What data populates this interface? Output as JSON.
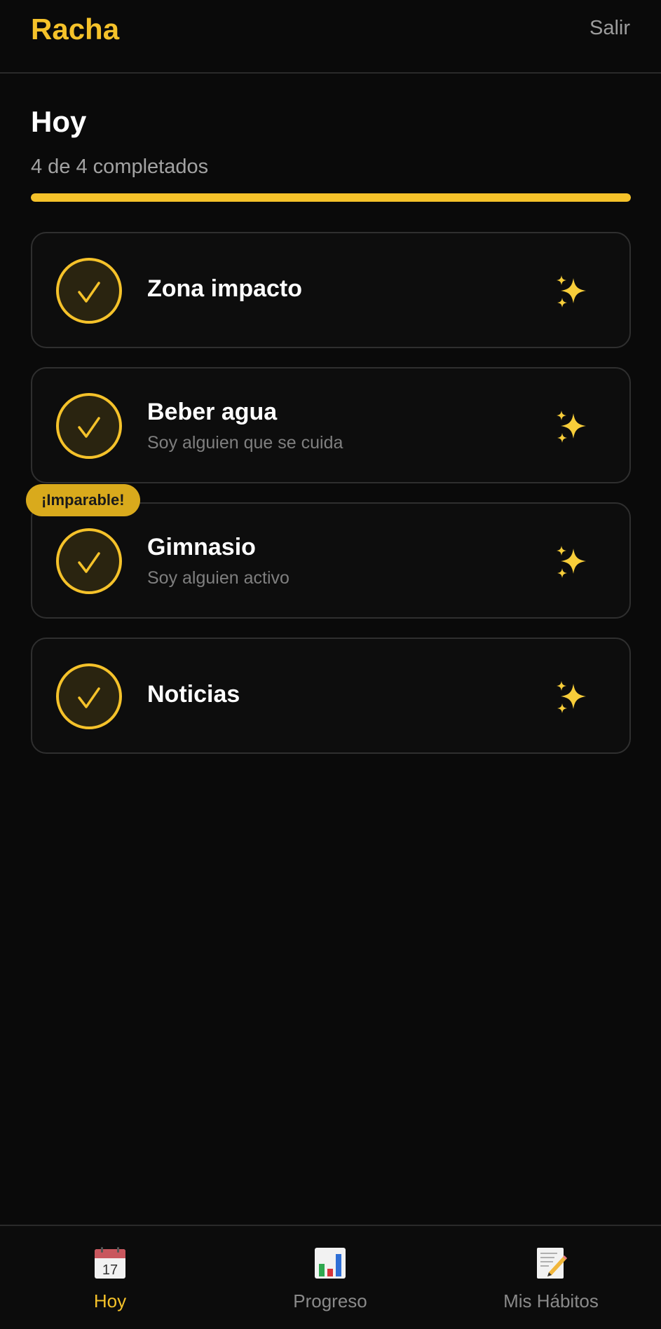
{
  "header": {
    "brand": "Racha",
    "logout_label": "Salir"
  },
  "today": {
    "title": "Hoy",
    "progress_text": "4 de 4 completados",
    "completed": 4,
    "total": 4,
    "progress_fraction": 1.0
  },
  "colors": {
    "accent": "#f5c22a",
    "background": "#0a0a0a",
    "badge": "#d9aa1c"
  },
  "habits": [
    {
      "name": "Zona impacto",
      "subtitle": "",
      "completed": true,
      "icon": "sparkles-icon"
    },
    {
      "name": "Beber agua",
      "subtitle": "Soy alguien que se cuida",
      "completed": true,
      "icon": "sparkles-icon"
    },
    {
      "name": "Gimnasio",
      "subtitle": "Soy alguien activo",
      "completed": true,
      "icon": "sparkles-icon",
      "badge": "¡Imparable!"
    },
    {
      "name": "Noticias",
      "subtitle": "",
      "completed": true,
      "icon": "sparkles-icon"
    }
  ],
  "nav": {
    "tabs": [
      {
        "label": "Hoy",
        "icon": "calendar-icon",
        "active": true
      },
      {
        "label": "Progreso",
        "icon": "bar-chart-icon",
        "active": false
      },
      {
        "label": "Mis Hábitos",
        "icon": "memo-icon",
        "active": false
      }
    ]
  }
}
